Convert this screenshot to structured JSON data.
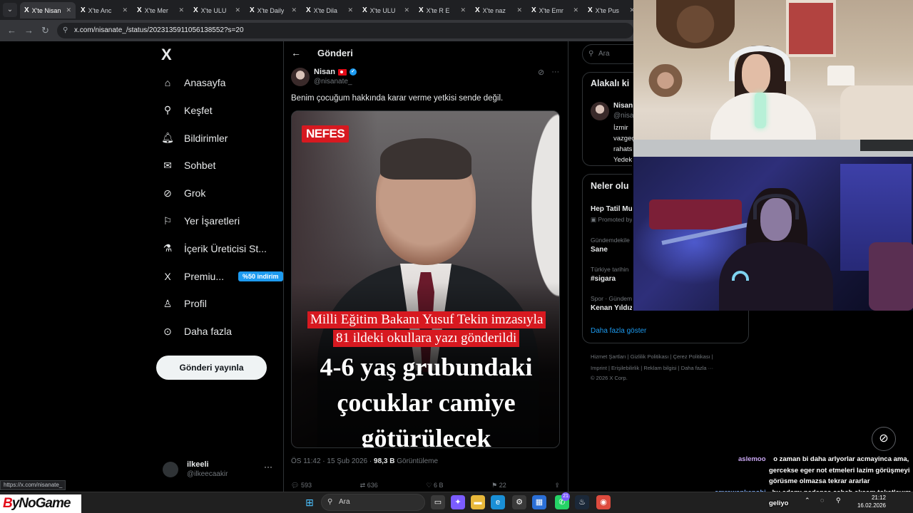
{
  "browser": {
    "tabs": [
      {
        "label": "X'te Nisan",
        "active": true
      },
      {
        "label": "X'te Anc"
      },
      {
        "label": "X'te Mer"
      },
      {
        "label": "X'te ULU"
      },
      {
        "label": "X'te Daily"
      },
      {
        "label": "X'te Dila"
      },
      {
        "label": "X'te ULU"
      },
      {
        "label": "X'te R E"
      },
      {
        "label": "X'te naz"
      },
      {
        "label": "X'te Emr"
      },
      {
        "label": "X'te Pus"
      }
    ],
    "url": "x.com/nisanate_/status/2023135911056138552?s=20"
  },
  "sidebar": {
    "logo": "X",
    "items": [
      {
        "label": "Anasayfa",
        "icon": "home-icon"
      },
      {
        "label": "Keşfet",
        "icon": "search-icon"
      },
      {
        "label": "Bildirimler",
        "icon": "bell-icon"
      },
      {
        "label": "Sohbet",
        "icon": "mail-icon"
      },
      {
        "label": "Grok",
        "icon": "grok-icon"
      },
      {
        "label": "Yer İşaretleri",
        "icon": "bookmark-icon"
      },
      {
        "label": "İçerik Üreticisi St...",
        "icon": "creator-studio-icon"
      },
      {
        "label": "Premiu...",
        "icon": "x-premium-icon",
        "badge": "%50 indirim"
      },
      {
        "label": "Profil",
        "icon": "person-icon"
      },
      {
        "label": "Daha fazla",
        "icon": "more-circle-icon"
      }
    ],
    "post_button": "Gönderi yayınla",
    "account": {
      "name": "ilkeeli",
      "handle": "@ilkeecaakir"
    }
  },
  "post": {
    "header_title": "Gönderi",
    "author_name": "Nisan",
    "author_handle": "@nisanate_",
    "text": "Benim çocuğum hakkında karar verme yetkisi sende değil.",
    "image": {
      "logo": "NEFES",
      "line1": "Milli Eğitim Bakanı Yusuf Tekin imzasıyla",
      "line2": "81 ildeki okullara yazı gönderildi",
      "headline_1": "4-6 yaş grubundaki",
      "headline_2": "çocuklar camiye",
      "headline_3": "götürülecek"
    },
    "time": "ÖS 11:42 · 15 Şub 2026 · ",
    "views": "98,3 B",
    "views_label": " Görüntüleme",
    "replies": "593",
    "reposts": "636",
    "likes": "6 B",
    "bookmarks": "22"
  },
  "right": {
    "search_placeholder": "Ara",
    "relevant_title": "Alakalı ki",
    "relevant_user": {
      "name": "Nisan",
      "handle": "@nisa",
      "bio_1": "İzmir",
      "bio_2": "vazgeç",
      "bio_3": "rahats",
      "bio_4": "Yedek"
    },
    "trends_title": "Neler olu",
    "trends": [
      {
        "context": "",
        "name": "Hep Tatil Mu",
        "promoted": "Promoted by"
      },
      {
        "context": "Gündemdekile",
        "name": "Sane"
      },
      {
        "context": "Türkiye tarihin",
        "name": "#sigara"
      },
      {
        "context": "Spor · Gündem",
        "name": "Kenan Yıldız"
      }
    ],
    "show_more": "Daha fazla göster",
    "footer_1": "Hizmet Şartları  |  Gizlilik Politikası  |  Çerez Politikası  |",
    "footer_2": "Imprint  |  Erişilebilirlik  |  Reklam bilgisi  |  Daha fazla ···",
    "footer_3": "© 2026 X Corp."
  },
  "chat": [
    {
      "user": "aslemoo",
      "text": "o zaman bi daha arlyorlar acmayinca ama,"
    },
    {
      "user": "",
      "text": "gercekse eger not etmeleri lazim görüşmeyi"
    },
    {
      "user": "",
      "text": "görüsme olmazsa tekrar ararlar"
    },
    {
      "user": "emrewankenobi",
      "text": "bu adamı nedense sabah akşam tokatlayım"
    },
    {
      "user": "",
      "text": "geliyo"
    }
  ],
  "status_url": "https://x.com/nisanate_",
  "taskbar": {
    "brand_mark": "B",
    "brand_rest": "yNoGame",
    "search": "Ara",
    "time": "21:12",
    "date": "16.02.2026",
    "notification_badge": "21"
  },
  "colors": {
    "accent": "#1d9bf0",
    "news_red": "#d71920",
    "background": "#000000"
  }
}
